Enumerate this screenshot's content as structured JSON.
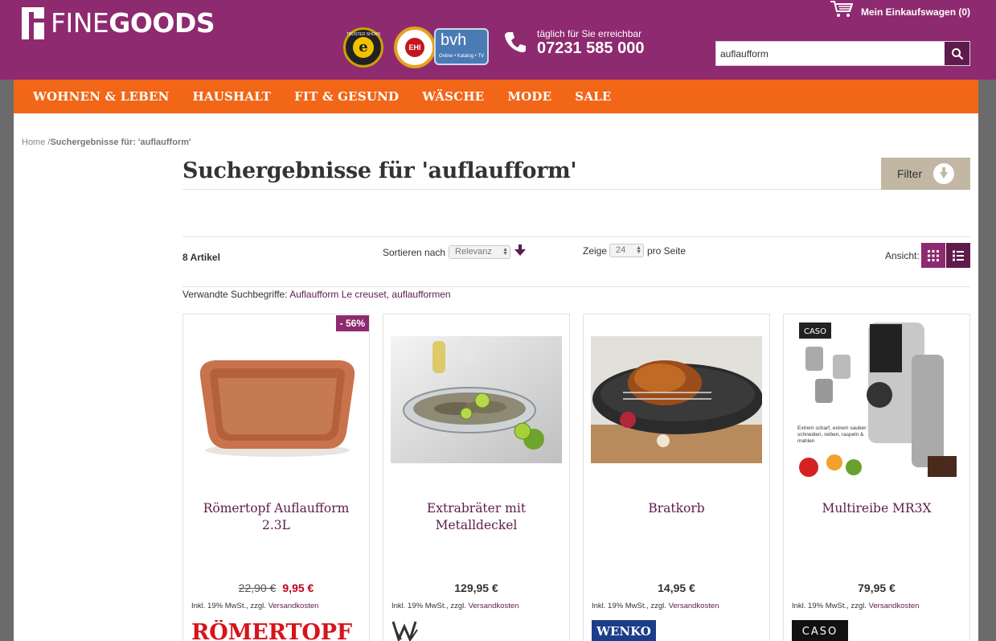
{
  "header": {
    "logo_light": "FINE",
    "logo_bold": "GOODS",
    "badge_ts_label": "e",
    "badge_ts_small": "TRUSTED SHOPS",
    "badge_ehi_label": "EHI",
    "badge_bvh_label": "bvh",
    "badge_bvh_small": "Online • Katalog • TV",
    "phone_hint": "täglich für Sie erreichbar",
    "phone_number": "07231 585 000",
    "cart_label": "Mein Einkaufswagen (0)",
    "search_value": "auflaufform"
  },
  "nav": {
    "items": [
      "WOHNEN & LEBEN",
      "HAUSHALT",
      "FIT & GESUND",
      "WÄSCHE",
      "MODE",
      "SALE"
    ]
  },
  "breadcrumb": {
    "home": "Home",
    "separator": " /",
    "current": "Suchergebnisse für: 'auflaufform'"
  },
  "page_title": "Suchergebnisse für 'auflaufform'",
  "filter_label": "Filter",
  "toolbar": {
    "count": "8 Artikel",
    "sort_label": "Sortieren nach",
    "sort_value": "Relevanz",
    "show_label": "Zeige",
    "show_value": "24",
    "per_page": "pro Seite",
    "view_label": "Ansicht:"
  },
  "related": {
    "label": "Verwandte Suchbegriffe: ",
    "term1": "Auflaufform Le creuset",
    "sep": ", ",
    "term2": "auflaufformen"
  },
  "products": [
    {
      "name": "Römertopf Auflaufform 2.3L",
      "old_price": "22,90 €",
      "price": "9,95 €",
      "discount": "- 56%",
      "brand": "RÖMERTOPF"
    },
    {
      "name": "Extrabräter mit Metalldeckel",
      "price": "129,95 €",
      "brand": "WMF"
    },
    {
      "name": "Bratkorb",
      "price": "14,95 €",
      "brand": "WENKO"
    },
    {
      "name": "Multireibe MR3X",
      "price": "79,95 €",
      "brand": "CASO",
      "img_label": "CASO",
      "img_text": "Extrem scharf, extrem sauber: schneiden, reiben, raspeln & mahlen"
    }
  ],
  "tax": {
    "text": "Inkl. 19% MwSt., zzgl. ",
    "link": "Versandkosten"
  },
  "colors": {
    "header": "#8e2a6f",
    "nav": "#f26618",
    "accent": "#5e1b4b",
    "sale": "#c0001a"
  }
}
